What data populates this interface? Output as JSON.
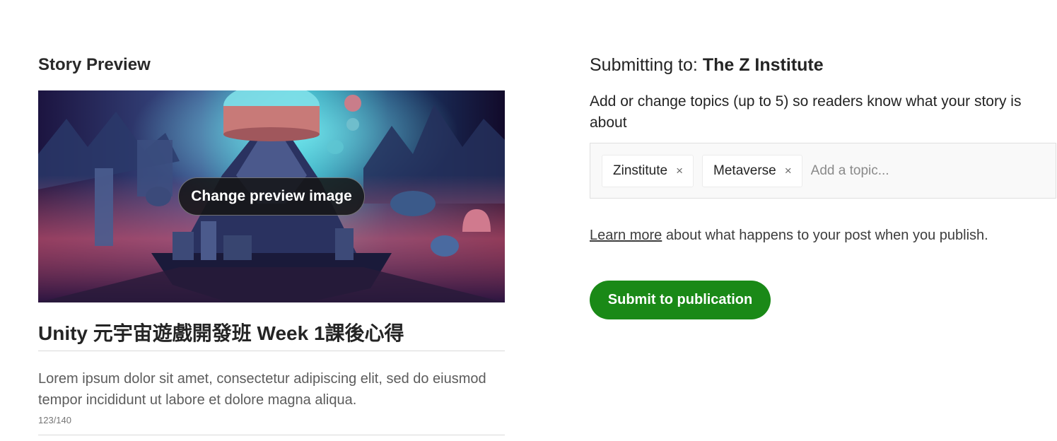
{
  "preview": {
    "section_title": "Story Preview",
    "change_image_label": "Change preview image",
    "story_title": "Unity 元宇宙遊戲開發班 Week 1課後心得",
    "story_subtitle": "Lorem ipsum dolor sit amet, consectetur adipiscing elit, sed do eiusmod tempor incididunt ut labore et dolore magna aliqua.",
    "char_count": "123/140"
  },
  "submission": {
    "prefix": "Submitting to:",
    "publication": "The Z Institute",
    "topics_help": "Add or change topics (up to 5) so readers know what your story is about",
    "topics": [
      {
        "label": "Zinstitute",
        "remove_icon": "×"
      },
      {
        "label": "Metaverse",
        "remove_icon": "×"
      }
    ],
    "topic_placeholder": "Add a topic...",
    "learn_more_link": "Learn more",
    "learn_more_rest": " about what happens to your post when you publish.",
    "submit_label": "Submit to publication"
  },
  "colors": {
    "submit_button": "#1a8917",
    "topics_box_bg": "#f9f9f9"
  }
}
